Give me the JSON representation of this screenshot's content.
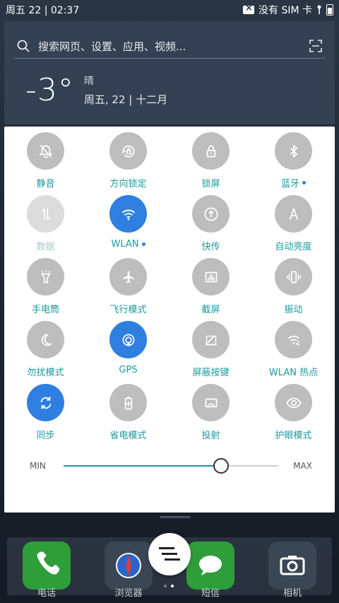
{
  "status_bar": {
    "datetime": "周五 22 | 02:37",
    "carrier": "没有 SIM 卡"
  },
  "search": {
    "placeholder_text": "搜索网页、设置、应用、视频..."
  },
  "weather": {
    "temperature": "-3°",
    "condition": "晴",
    "date": "周五, 22 | 十二月"
  },
  "quick_settings": {
    "tiles": [
      {
        "label": "静音",
        "icon": "mute-bell-icon",
        "state": "off"
      },
      {
        "label": "方向锁定",
        "icon": "rotation-lock-icon",
        "state": "off"
      },
      {
        "label": "锁屏",
        "icon": "lock-icon",
        "state": "off"
      },
      {
        "label": "蓝牙",
        "icon": "bluetooth-icon",
        "state": "off",
        "has_dot": true
      },
      {
        "label": "数据",
        "icon": "data-arrows-icon",
        "state": "disabled"
      },
      {
        "label": "WLAN",
        "icon": "wifi-icon",
        "state": "on",
        "has_dot": true
      },
      {
        "label": "快传",
        "icon": "quick-transfer-icon",
        "state": "off"
      },
      {
        "label": "自动亮度",
        "icon": "auto-brightness-icon",
        "state": "off"
      },
      {
        "label": "手电筒",
        "icon": "flashlight-icon",
        "state": "off"
      },
      {
        "label": "飞行模式",
        "icon": "airplane-icon",
        "state": "off"
      },
      {
        "label": "截屏",
        "icon": "screenshot-icon",
        "state": "off"
      },
      {
        "label": "振动",
        "icon": "vibrate-icon",
        "state": "off"
      },
      {
        "label": "勿扰模式",
        "icon": "moon-icon",
        "state": "off"
      },
      {
        "label": "GPS",
        "icon": "gps-icon",
        "state": "on"
      },
      {
        "label": "屏蔽按键",
        "icon": "block-keys-icon",
        "state": "off"
      },
      {
        "label": "WLAN 热点",
        "icon": "hotspot-icon",
        "state": "off"
      },
      {
        "label": "同步",
        "icon": "sync-icon",
        "state": "on"
      },
      {
        "label": "省电模式",
        "icon": "battery-saver-icon",
        "state": "off"
      },
      {
        "label": "投射",
        "icon": "cast-icon",
        "state": "off"
      },
      {
        "label": "护眼模式",
        "icon": "eye-icon",
        "state": "off"
      }
    ]
  },
  "brightness": {
    "min_label": "MIN",
    "max_label": "MAX",
    "level": 0.735
  },
  "dock": {
    "apps": [
      {
        "label": "电话",
        "icon": "phone-icon",
        "color": "#2e9e3a"
      },
      {
        "label": "浏览器",
        "icon": "compass-icon",
        "color": "#3b4654"
      },
      {
        "label": "短信",
        "icon": "message-icon",
        "color": "#2e9e3a"
      },
      {
        "label": "相机",
        "icon": "camera-icon",
        "color": "#3b4654"
      }
    ]
  },
  "colors": {
    "accent_active": "#2f7fe0",
    "label_teal": "#1a9aa0",
    "tile_inactive": "#bdbdbd"
  }
}
